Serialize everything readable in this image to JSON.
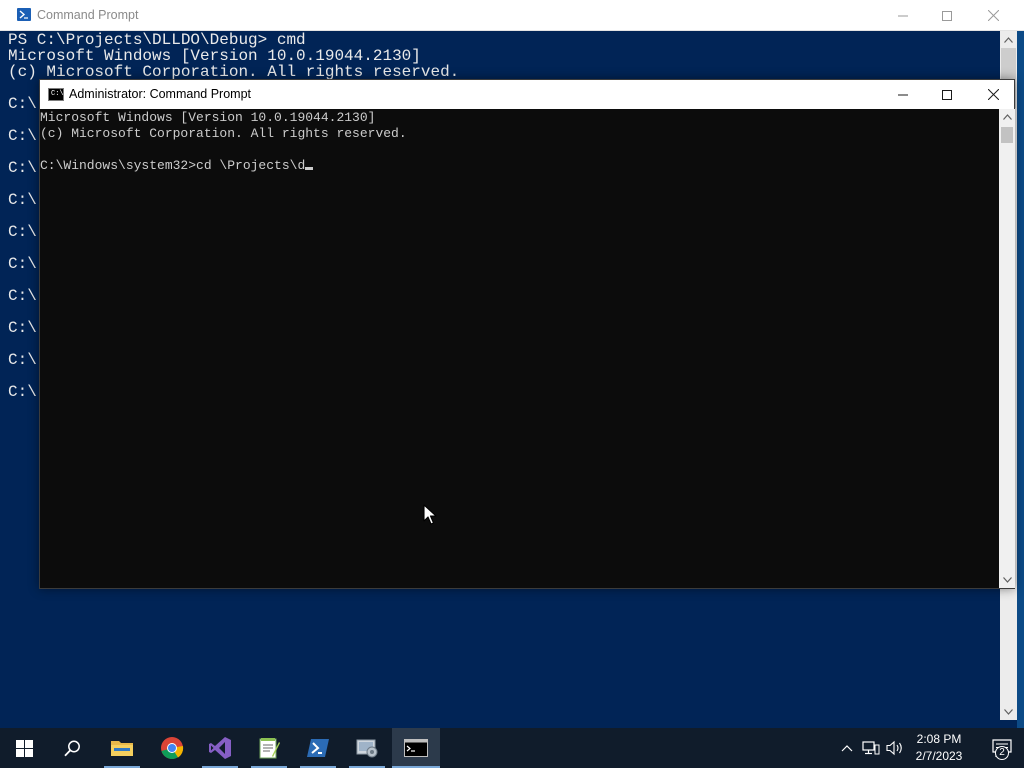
{
  "back_window": {
    "title": "Command Prompt",
    "lines": [
      "PS C:\\Projects\\DLLDO\\Debug> cmd",
      "Microsoft Windows [Version 10.0.19044.2130]",
      "(c) Microsoft Corporation. All rights reserved."
    ],
    "prompts": [
      "C:\\",
      "C:\\",
      "C:\\",
      "C:\\",
      "C:\\",
      "C:\\",
      "C:\\",
      "C:\\",
      "C:\\",
      "C:\\"
    ]
  },
  "front_window": {
    "title": "Administrator: Command Prompt",
    "icon_text": "C:\\",
    "lines": [
      "Microsoft Windows [Version 10.0.19044.2130]",
      "(c) Microsoft Corporation. All rights reserved.",
      "",
      "C:\\Windows\\system32>cd \\Projects\\d"
    ]
  },
  "taskbar": {
    "apps": [
      {
        "name": "start-button",
        "icon": "windows-logo-icon"
      },
      {
        "name": "search-button",
        "icon": "search-icon"
      },
      {
        "name": "file-explorer",
        "icon": "folder-icon"
      },
      {
        "name": "chrome",
        "icon": "chrome-icon"
      },
      {
        "name": "visual-studio",
        "icon": "visual-studio-icon"
      },
      {
        "name": "notepad-plus-plus",
        "icon": "notepad-plus-plus-icon"
      },
      {
        "name": "powershell",
        "icon": "powershell-icon"
      },
      {
        "name": "system-app",
        "icon": "gear-app-icon"
      },
      {
        "name": "command-prompt",
        "icon": "command-prompt-icon"
      }
    ],
    "clock": {
      "time": "2:08 PM",
      "date": "2/7/2023"
    },
    "notification_count": "2"
  },
  "colors": {
    "powershell_bg": "#012456",
    "cmd_bg": "#0c0c0c",
    "taskbar_bg": "#101c2b",
    "desktop_bg": "#0c4a86"
  }
}
